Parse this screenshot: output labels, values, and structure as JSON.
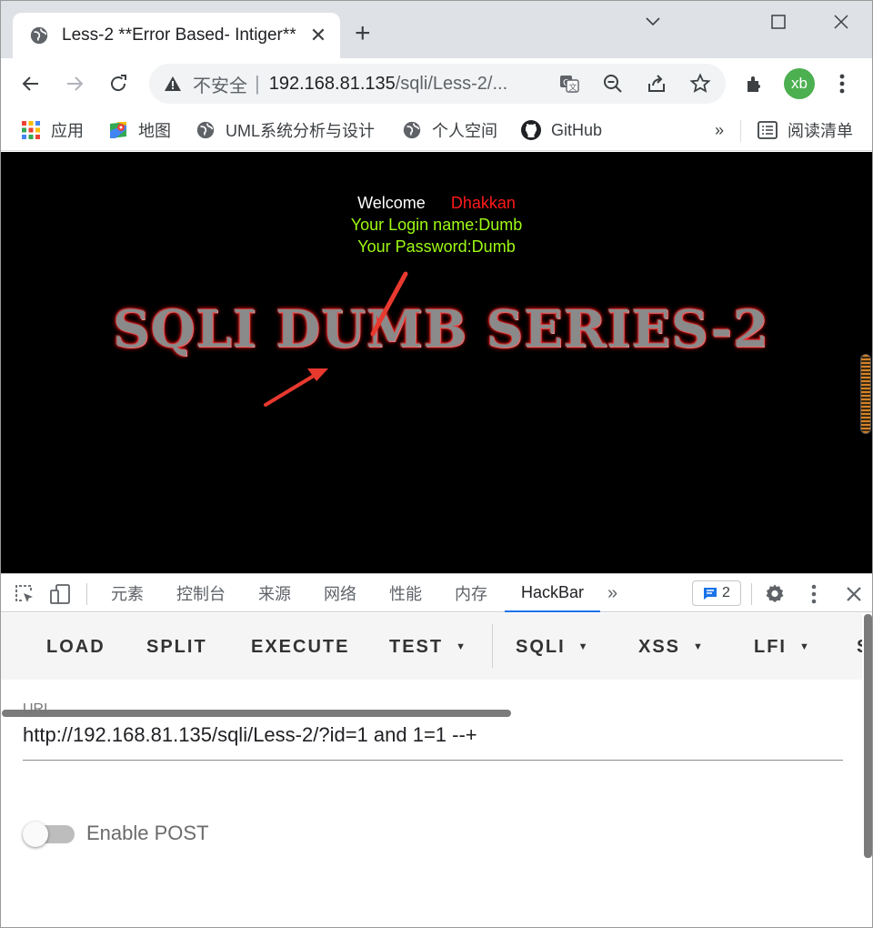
{
  "browser": {
    "tab": {
      "title": "Less-2 **Error Based- Intiger**",
      "close": "✕"
    },
    "new_tab": "+",
    "window": {
      "minimize": "minimize",
      "maximize": "maximize",
      "close": "close"
    },
    "omnibox": {
      "security_label": "不安全",
      "separator": "|",
      "url_host": "192.168.81.135",
      "url_path": "/sqli/Less-2/..."
    },
    "profile_initials": "xb",
    "bookmarks": [
      {
        "label": "应用",
        "icon": "apps-grid-icon"
      },
      {
        "label": "地图",
        "icon": "maps-icon"
      },
      {
        "label": "UML系统分析与设计",
        "icon": "globe-icon"
      },
      {
        "label": "个人空间",
        "icon": "globe-icon"
      },
      {
        "label": "GitHub",
        "icon": "github-icon"
      }
    ],
    "bookmarks_overflow": "»",
    "reading_list": "阅读清单"
  },
  "page": {
    "welcome": "Welcome",
    "user": "Dhakkan",
    "login_name": "Your Login name:Dumb",
    "password": "Your Password:Dumb",
    "banner": "SQLI DUMB SERIES-2"
  },
  "devtools": {
    "tabs": [
      "元素",
      "控制台",
      "来源",
      "网络",
      "性能",
      "内存",
      "HackBar"
    ],
    "active_tab": "HackBar",
    "overflow": "»",
    "issues_count": "2"
  },
  "hackbar": {
    "buttons": [
      {
        "label": "LOAD"
      },
      {
        "label": "SPLIT"
      },
      {
        "label": "EXECUTE"
      },
      {
        "label": "TEST"
      },
      {
        "label": "SQLI"
      },
      {
        "label": "XSS"
      },
      {
        "label": "LFI"
      }
    ],
    "url_label": "URL",
    "url_value": "http://192.168.81.135/sqli/Less-2/?id=1 and 1=1 --+",
    "enable_post_label": "Enable POST",
    "enable_post": false
  },
  "colors": {
    "active_tab_underline": "#1a73e8",
    "welcome_user": "#ff1a1a",
    "login_text": "#9efa12",
    "avatar": "#4caf50"
  }
}
